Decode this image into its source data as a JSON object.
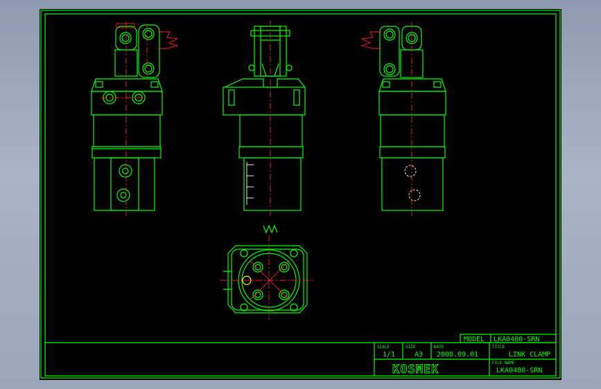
{
  "title_block": {
    "model_label": "MODEL",
    "model_value": "LKA0480-SRN",
    "scale_label": "SCALE",
    "scale_value": "1/1",
    "size_label": "SIZE",
    "size_value": "A3",
    "date_label": "DATE",
    "date_value": "2008.09.01",
    "title_label": "TITLE",
    "title_value": "LINK CLAMP",
    "file_label": "FILE NAME",
    "file_value": "LKA0480-SRN",
    "logo_text": "KOSMEK"
  },
  "colors": {
    "outline": "#00ff00",
    "center_line": "#ff2020",
    "hidden_line": "#e8e8e8",
    "highlight": "#ffff00",
    "paper": "#000000"
  },
  "views": [
    "front-view",
    "side-view",
    "rear-view",
    "top-view"
  ]
}
